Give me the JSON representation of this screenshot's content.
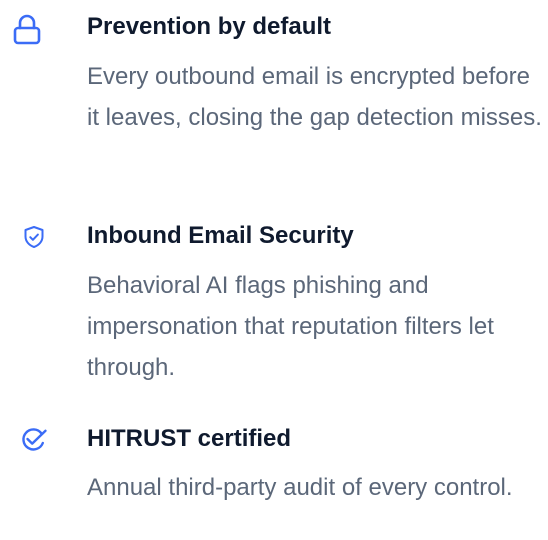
{
  "colors": {
    "icon": "#3b6cf6",
    "title": "#0f1a2e",
    "description": "#5b6779",
    "background": "#ffffff"
  },
  "features": [
    {
      "icon": "lock-icon",
      "title": "Prevention by default",
      "description": "Every outbound email is encrypted before it leaves, closing the gap detection misses."
    },
    {
      "icon": "shield-check-icon",
      "title": "Inbound Email Security",
      "description": "Behavioral AI flags phishing and impersonation that reputation filters let through."
    },
    {
      "icon": "badge-check-icon",
      "title": "HITRUST certified",
      "description": "Annual third-party audit of every control."
    }
  ]
}
